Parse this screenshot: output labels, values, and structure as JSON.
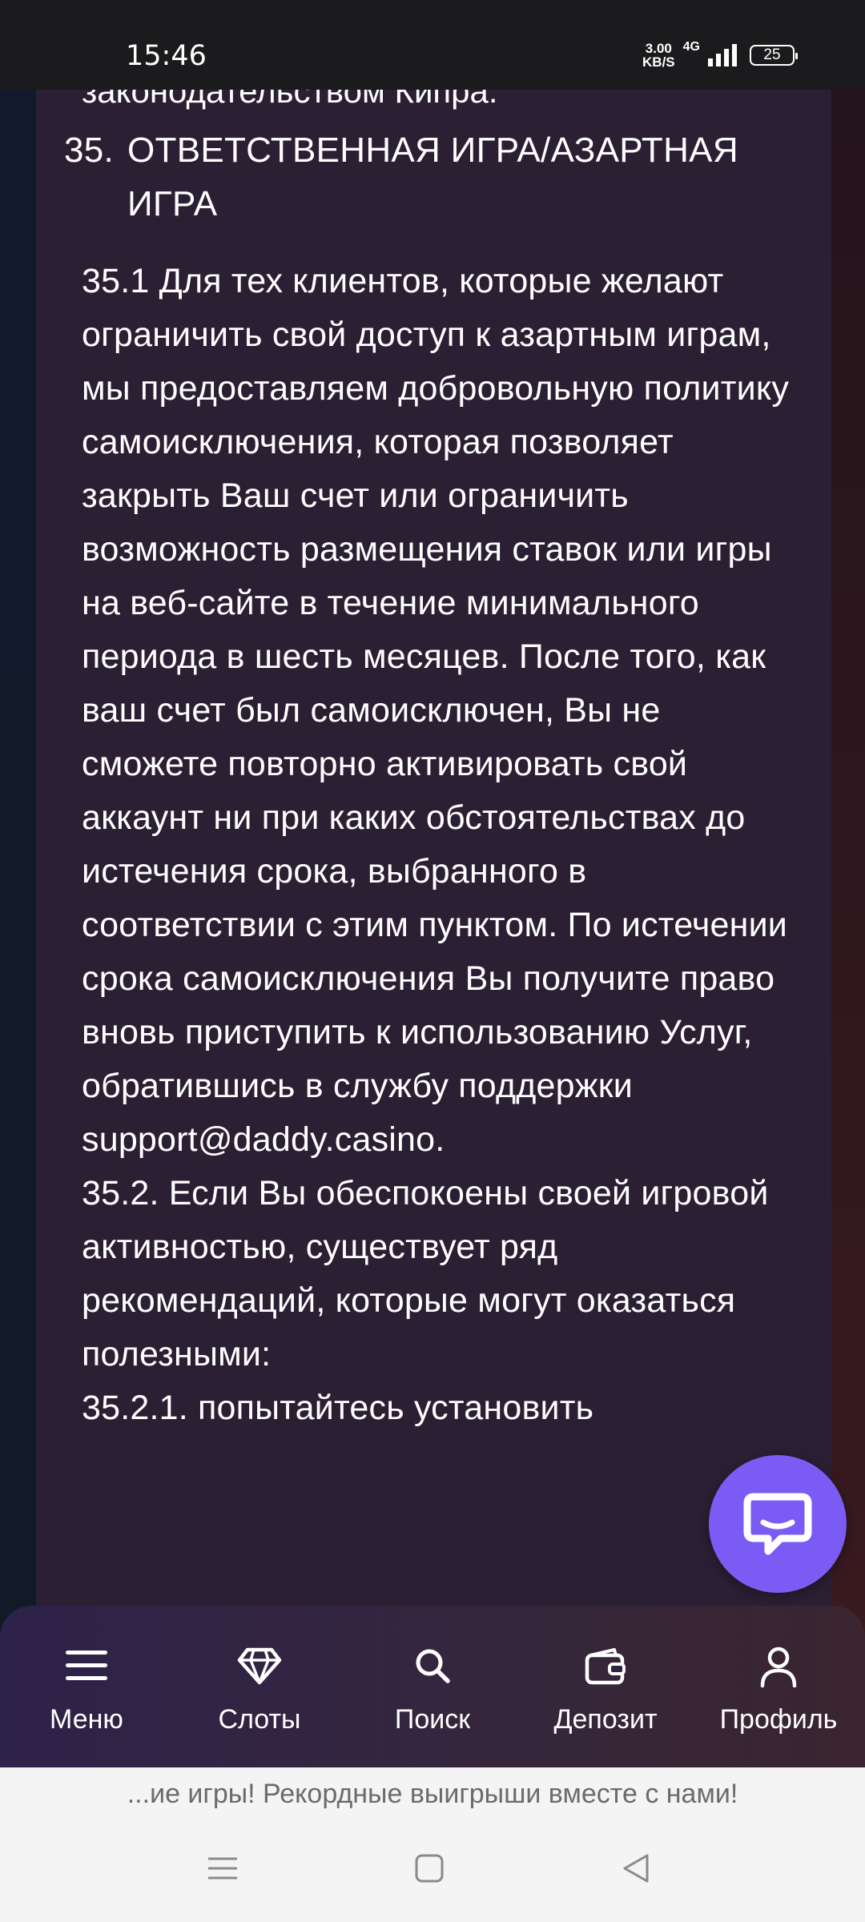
{
  "status_bar": {
    "time": "15:46",
    "net_speed_value": "3.00",
    "net_speed_unit": "KB/S",
    "network_type": "4G",
    "battery": "25"
  },
  "article": {
    "clipped_line": "законодательством Кипра.",
    "section_number": "35.",
    "section_title": "ОТВЕТСТВЕННАЯ ИГРА/АЗАРТНАЯ ИГРА",
    "paragraphs": [
      "35.1 Для тех клиентов, которые желают ограничить свой доступ к азартным играм, мы предоставляем добровольную политику самоисключения, которая позволяет закрыть Ваш счет или ограничить возможность размещения ставок или игры на веб-сайте в течение минимального периода в шесть месяцев. После того, как ваш счет был самоисключен, Вы не сможете повторно активировать свой аккаунт ни при каких обстоятельствах до истечения срока, выбранного в соответствии с этим пунктом. По истечении срока самоисключения Вы получите право вновь приступить к использованию Услуг, обратившись в службу поддержки support@daddy.casino.",
      "35.2. Если Вы обеспокоены своей игровой активностью, существует ряд рекомендаций, которые могут оказаться полезными:",
      "35.2.1. попытайтесь установить"
    ]
  },
  "chat_button": {
    "icon": "chat-bubble-icon"
  },
  "bottom_nav": {
    "items": [
      {
        "label": "Меню",
        "icon": "hamburger-menu-icon"
      },
      {
        "label": "Слоты",
        "icon": "diamond-icon"
      },
      {
        "label": "Поиск",
        "icon": "search-icon"
      },
      {
        "label": "Депозит",
        "icon": "wallet-icon"
      },
      {
        "label": "Профиль",
        "icon": "user-icon"
      }
    ]
  },
  "banner": {
    "text": "...ие игры! Рекордные выигрыши вместе с нами!"
  },
  "colors": {
    "panel": "#2a1f33",
    "accent": "#7a5cf5",
    "nav_bg": "#2d2249"
  }
}
